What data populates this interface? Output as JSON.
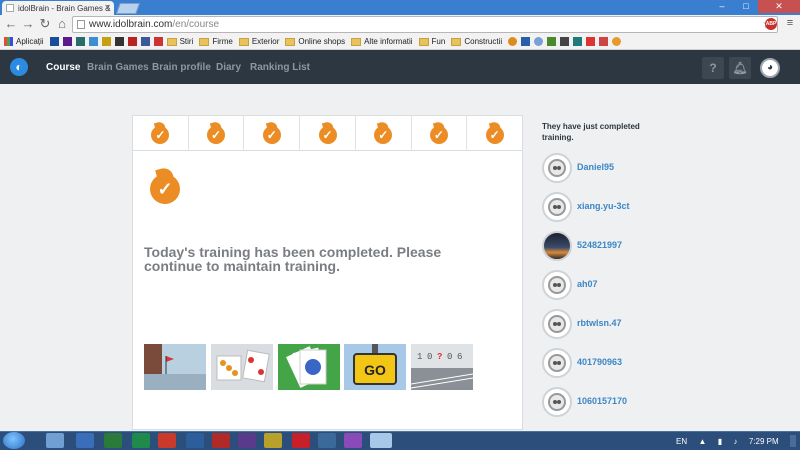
{
  "browser": {
    "tab_title": "idolBrain - Brain Games &",
    "url_domain": "www.idolbrain.com",
    "url_path": "/en/course",
    "bookmarks": [
      "Aplicații",
      "Stiri",
      "Firme",
      "Exterior",
      "Online shops",
      "Alte informatii",
      "Fun",
      "Constructii"
    ]
  },
  "nav": {
    "links": [
      "Course",
      "Brain Games",
      "Brain profile",
      "Diary",
      "Ranking List"
    ],
    "help": "?"
  },
  "course": {
    "completed_days": 7,
    "message": "Today's training has been completed. Please continue to maintain training."
  },
  "rail": {
    "title": "They have just completed training.",
    "users": [
      "Daniel95",
      "xiang.yu-3ct",
      "524821997",
      "ah07",
      "rbtwlsn.47",
      "401790963",
      "1060157170"
    ]
  },
  "thumbs": {
    "number_game": [
      "1",
      "0",
      "?",
      "0",
      "6"
    ],
    "go_sign": "GO"
  },
  "taskbar": {
    "lang": "EN",
    "time": "7:29 PM"
  },
  "colors": {
    "accent": "#ec8c25",
    "nav_bg": "#2d3741",
    "link": "#3d86c6"
  }
}
